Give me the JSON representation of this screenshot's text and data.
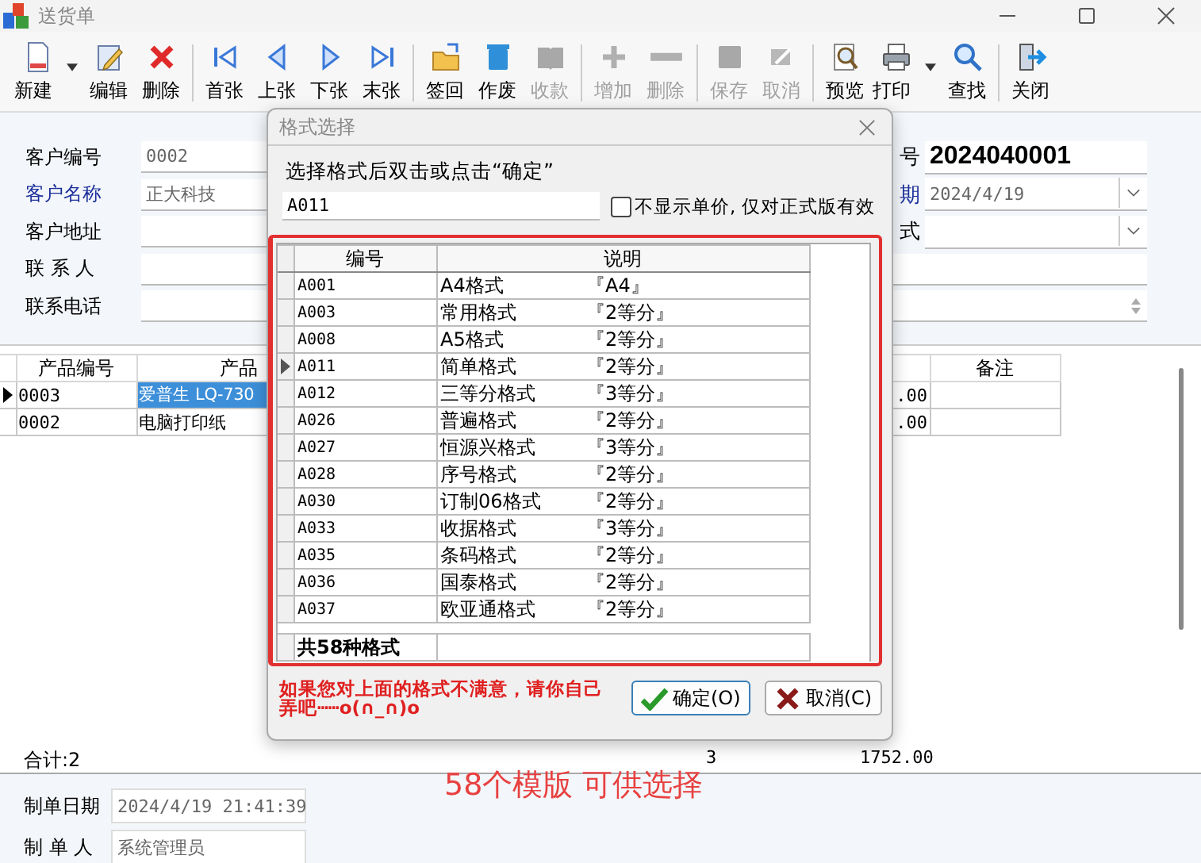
{
  "window": {
    "title": "送货单"
  },
  "toolbar": [
    [
      {
        "label": "新建",
        "kind": "new",
        "disabled": false,
        "dropdown": true
      },
      {
        "label": "编辑",
        "kind": "edit",
        "disabled": false,
        "dropdown": false
      },
      {
        "label": "删除",
        "kind": "delete",
        "disabled": false,
        "dropdown": false
      }
    ],
    [
      {
        "label": "首张",
        "kind": "first",
        "disabled": false,
        "dropdown": false
      },
      {
        "label": "上张",
        "kind": "prev",
        "disabled": false,
        "dropdown": false
      },
      {
        "label": "下张",
        "kind": "next",
        "disabled": false,
        "dropdown": false
      },
      {
        "label": "末张",
        "kind": "last",
        "disabled": false,
        "dropdown": false
      }
    ],
    [
      {
        "label": "签回",
        "kind": "folder",
        "disabled": false,
        "dropdown": false
      },
      {
        "label": "作废",
        "kind": "trash",
        "disabled": false,
        "dropdown": false
      },
      {
        "label": "收款",
        "kind": "book",
        "disabled": true,
        "dropdown": false
      }
    ],
    [
      {
        "label": "增加",
        "kind": "plus",
        "disabled": true,
        "dropdown": false
      },
      {
        "label": "删除",
        "kind": "minus",
        "disabled": true,
        "dropdown": false
      }
    ],
    [
      {
        "label": "保存",
        "kind": "save",
        "disabled": true,
        "dropdown": false
      },
      {
        "label": "取消",
        "kind": "undo",
        "disabled": true,
        "dropdown": false
      }
    ],
    [
      {
        "label": "预览",
        "kind": "preview",
        "disabled": false,
        "dropdown": false
      },
      {
        "label": "打印",
        "kind": "print",
        "disabled": false,
        "dropdown": true
      },
      {
        "label": "查找",
        "kind": "search",
        "disabled": false,
        "dropdown": false
      }
    ],
    [
      {
        "label": "关闭",
        "kind": "exit",
        "disabled": false,
        "dropdown": false
      }
    ]
  ],
  "form": {
    "left": [
      {
        "label": "客户编号",
        "value": "0002",
        "highlight": false,
        "kind": "short"
      },
      {
        "label": "客户名称",
        "value": "正大科技",
        "highlight": true,
        "kind": "short"
      },
      {
        "label": "客户地址",
        "highlight": false,
        "kind": "short"
      },
      {
        "label": "联 系 人",
        "highlight": false,
        "kind": "wide"
      },
      {
        "label": "联系电话",
        "highlight": false,
        "kind": "memo"
      }
    ],
    "right": [
      {
        "label": "号",
        "value": "2024040001",
        "highlight": false,
        "kind": "bold"
      },
      {
        "label": "期",
        "value": "2024/4/19",
        "highlight": true,
        "kind": "combo"
      },
      {
        "label": "式",
        "highlight": false,
        "kind": "combo"
      }
    ]
  },
  "grid": {
    "columns": [
      "产品编号",
      "产品",
      "",
      "备注"
    ],
    "rows": [
      {
        "selected": true,
        "cells": [
          "0003",
          "爱普生 LQ-730",
          ".00",
          ""
        ]
      },
      {
        "selected": false,
        "cells": [
          "0002",
          "电脑打印纸",
          ".00",
          ""
        ]
      }
    ],
    "totals": {
      "label": "合计:2",
      "quantity": "3",
      "amount": "1752.00"
    }
  },
  "footer": [
    {
      "label": "制单日期",
      "value": "2024/4/19 21:41:39"
    },
    {
      "label": "制 单 人",
      "value": "系统管理员"
    }
  ],
  "dialog": {
    "title": "格式选择",
    "instruction": "选择格式后双击或点击“确定”",
    "input": "A011",
    "checkbox": {
      "label": "不显示单价, 仅对正式版有效",
      "checked": false
    },
    "columns": [
      "编号",
      "说明"
    ],
    "rows": [
      {
        "code": "A001",
        "name": "A4格式",
        "split": "『A4』",
        "selected": false
      },
      {
        "code": "A003",
        "name": "常用格式",
        "split": "『2等分』",
        "selected": false
      },
      {
        "code": "A008",
        "name": "A5格式",
        "split": "『2等分』",
        "selected": false
      },
      {
        "code": "A011",
        "name": "简单格式",
        "split": "『2等分』",
        "selected": true
      },
      {
        "code": "A012",
        "name": "三等分格式",
        "split": "『3等分』",
        "selected": false
      },
      {
        "code": "A026",
        "name": "普遍格式",
        "split": "『2等分』",
        "selected": false
      },
      {
        "code": "A027",
        "name": "恒源兴格式",
        "split": "『3等分』",
        "selected": false
      },
      {
        "code": "A028",
        "name": "序号格式",
        "split": "『2等分』",
        "selected": false
      },
      {
        "code": "A030",
        "name": "订制06格式",
        "split": "『2等分』",
        "selected": false
      },
      {
        "code": "A033",
        "name": "收据格式",
        "split": "『3等分』",
        "selected": false
      },
      {
        "code": "A035",
        "name": "条码格式",
        "split": "『2等分』",
        "selected": false
      },
      {
        "code": "A036",
        "name": "国泰格式",
        "split": "『2等分』",
        "selected": false
      },
      {
        "code": "A037",
        "name": "欧亚通格式",
        "split": "『2等分』",
        "selected": false
      }
    ],
    "summary": "共58种格式",
    "message": "如果您对上面的格式不满意，请你自己弄吧┅┅o(∩_∩)o",
    "buttons": [
      {
        "label": "确定(O)",
        "kind": "ok"
      },
      {
        "label": "取消(C)",
        "kind": "cancel"
      }
    ]
  },
  "annotation": "58个模版 可供选择"
}
